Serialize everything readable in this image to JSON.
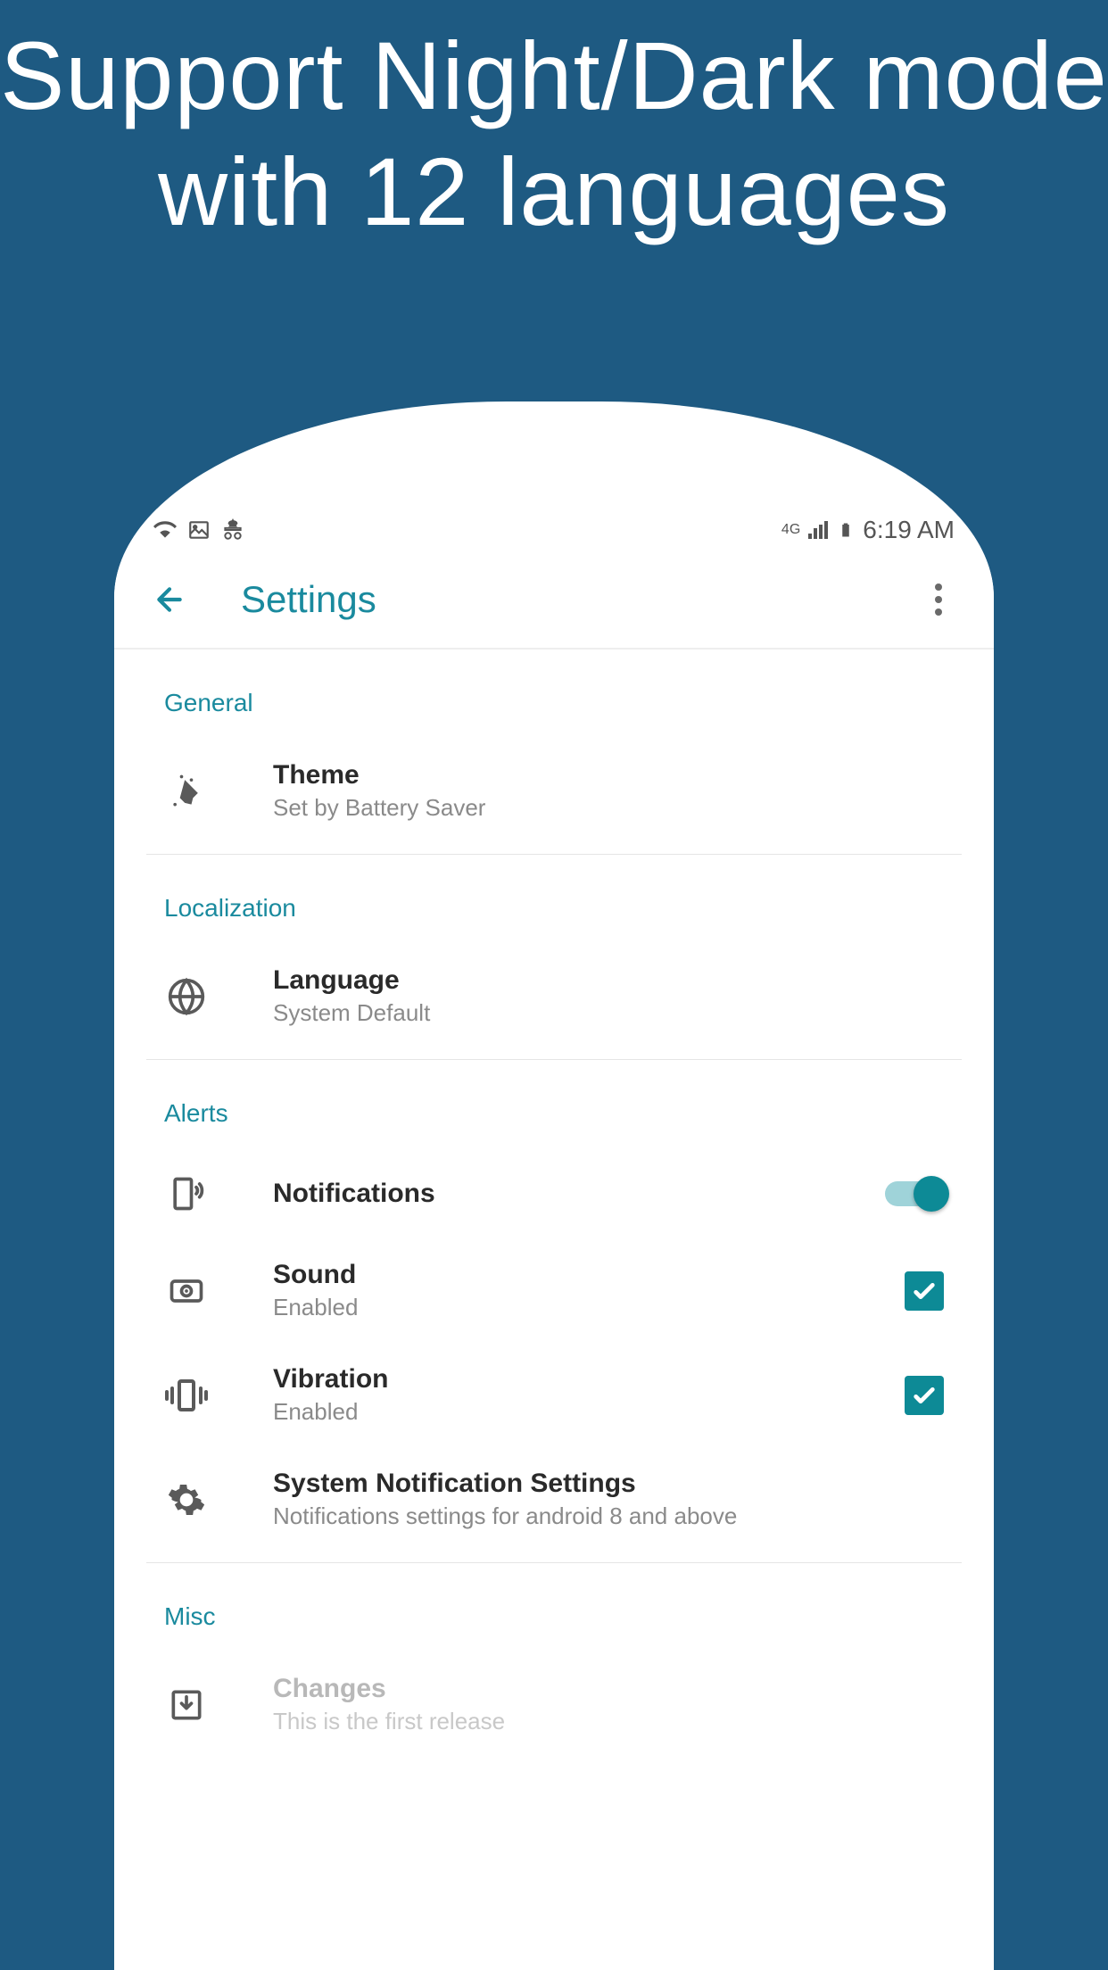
{
  "promo": {
    "title": "Support Night/Dark mode with 12 languages"
  },
  "status": {
    "time": "6:19 AM",
    "network": "4G"
  },
  "appbar": {
    "title": "Settings"
  },
  "sections": {
    "general": {
      "label": "General",
      "theme": {
        "title": "Theme",
        "subtitle": "Set by Battery Saver"
      }
    },
    "localization": {
      "label": "Localization",
      "language": {
        "title": "Language",
        "subtitle": "System Default"
      }
    },
    "alerts": {
      "label": "Alerts",
      "notifications": {
        "title": "Notifications",
        "enabled": true
      },
      "sound": {
        "title": "Sound",
        "subtitle": "Enabled",
        "checked": true
      },
      "vibration": {
        "title": "Vibration",
        "subtitle": "Enabled",
        "checked": true
      },
      "system": {
        "title": "System Notification Settings",
        "subtitle": "Notifications settings for android 8 and above"
      }
    },
    "misc": {
      "label": "Misc",
      "changes": {
        "title": "Changes",
        "subtitle": "This is the first release"
      }
    }
  }
}
